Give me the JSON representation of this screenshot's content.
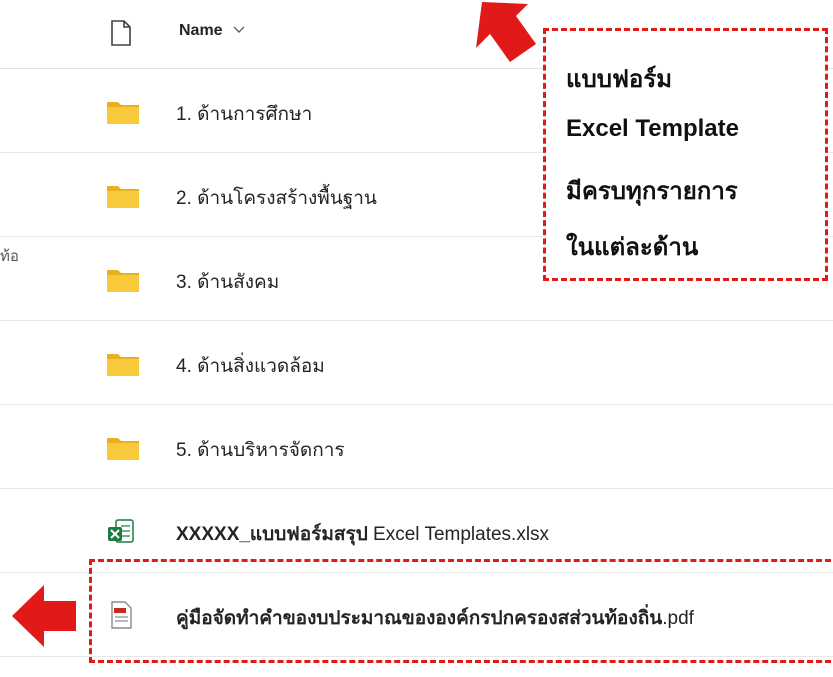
{
  "left_panel": {
    "stub_text": "ท้อ"
  },
  "header": {
    "name_label": "Name"
  },
  "rows": [
    {
      "name": "1. ด้านการศึกษา",
      "kind": "folder"
    },
    {
      "name": "2. ด้านโครงสร้างพื้นฐาน",
      "kind": "folder"
    },
    {
      "name": "3. ด้านสังคม",
      "kind": "folder"
    },
    {
      "name": "4. ด้านสิ่งแวดล้อม",
      "kind": "folder"
    },
    {
      "name": "5. ด้านบริหารจัดการ",
      "kind": "folder"
    },
    {
      "name_prefix": "XXXXX_แบบฟอร์มสรุป",
      "name_suffix": " Excel Templates.xlsx",
      "kind": "excel"
    },
    {
      "name_prefix": "คู่มือจัดทำคำของบประมาณขององค์กรปกครองสส่วนท้องถิ่น",
      "name_suffix": ".pdf",
      "kind": "pdf"
    }
  ],
  "callout": {
    "lines": [
      "แบบฟอร์ม",
      "Excel Template",
      "มีครบทุกรายการ",
      "ในแต่ละด้าน"
    ]
  },
  "colors": {
    "accent_red": "#e11919",
    "folder_yellow": "#f8c93a",
    "excel_green": "#1d7a43",
    "pdf_red": "#c42b1c"
  }
}
